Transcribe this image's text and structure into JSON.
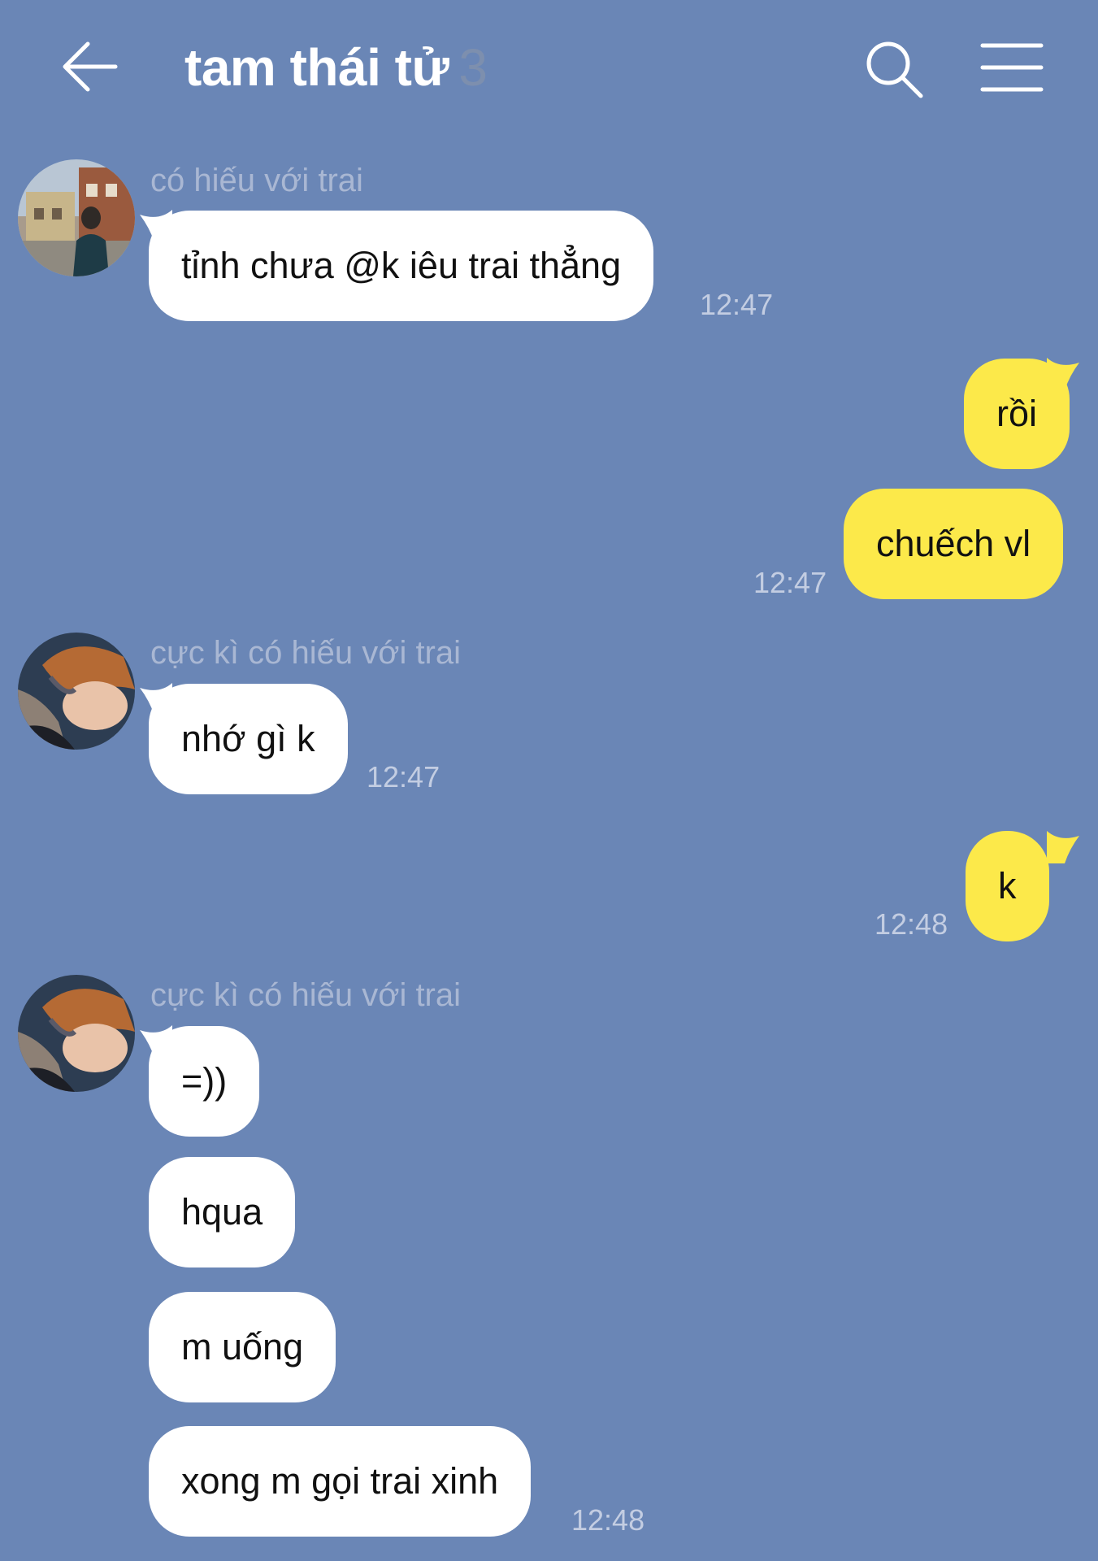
{
  "header": {
    "title": "tam thái tử",
    "member_count": "3",
    "back_icon": "arrow-left-icon",
    "search_icon": "search-icon",
    "menu_icon": "hamburger-menu-icon"
  },
  "colors": {
    "background": "#6a86b6",
    "incoming_bubble": "#ffffff",
    "outgoing_bubble": "#fce94a"
  },
  "messages": [
    {
      "direction": "in",
      "sender": "có hiếu với trai",
      "text": "tỉnh chưa @k iêu trai thẳng",
      "time": "12:47"
    },
    {
      "direction": "out",
      "text": "rồi",
      "time": ""
    },
    {
      "direction": "out",
      "text": "chuếch vl",
      "time": "12:47"
    },
    {
      "direction": "in",
      "sender": "cực kì có hiếu với trai",
      "text": "nhớ gì k",
      "time": "12:47"
    },
    {
      "direction": "out",
      "text": "k",
      "time": "12:48"
    },
    {
      "direction": "in",
      "sender": "cực kì có hiếu với trai",
      "text": "=))",
      "time": ""
    },
    {
      "direction": "in",
      "text": "hqua",
      "time": ""
    },
    {
      "direction": "in",
      "text": "m uống",
      "time": ""
    },
    {
      "direction": "in",
      "text": "xong m gọi trai xinh",
      "time": "12:48"
    }
  ]
}
